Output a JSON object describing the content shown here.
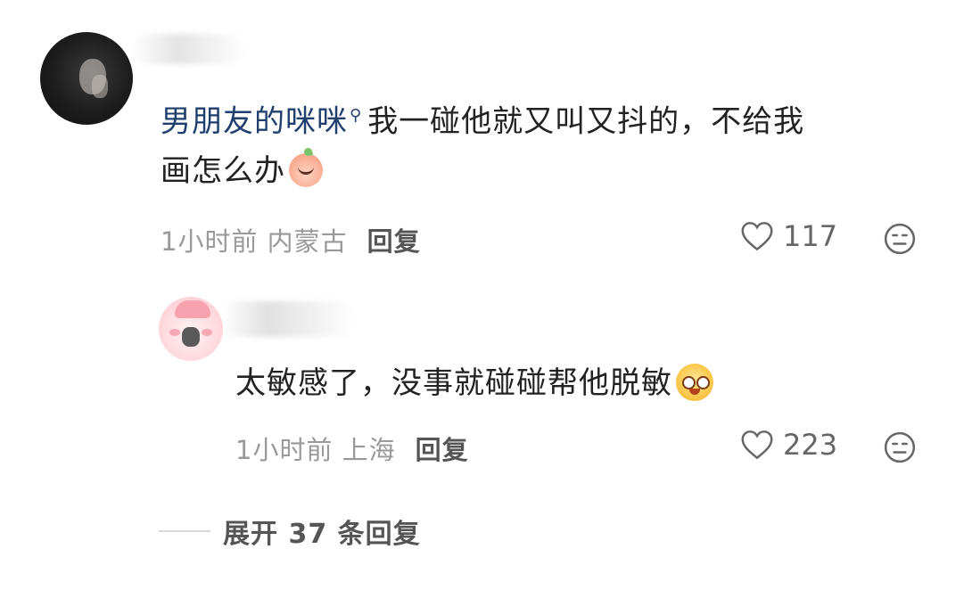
{
  "comment": {
    "author_tag": "男朋友的咪咪",
    "text_line1": "我一碰他就又叫又抖的，不给我",
    "text_line2": "画怎么办",
    "emoji": "bubble-smile-emoji",
    "time_location": "1小时前 内蒙古",
    "reply_label": "回复",
    "like_count": "117"
  },
  "reply": {
    "text": "太敏感了，没事就碰碰帮他脱敏",
    "emoji": "gold-surprised-emoji",
    "time_location": "1小时前 上海",
    "reply_label": "回复",
    "like_count": "223"
  },
  "expand": {
    "label": "展开 37 条回复"
  },
  "colors": {
    "author": "#1f3f6e",
    "meta": "#999999",
    "text": "#222222"
  }
}
